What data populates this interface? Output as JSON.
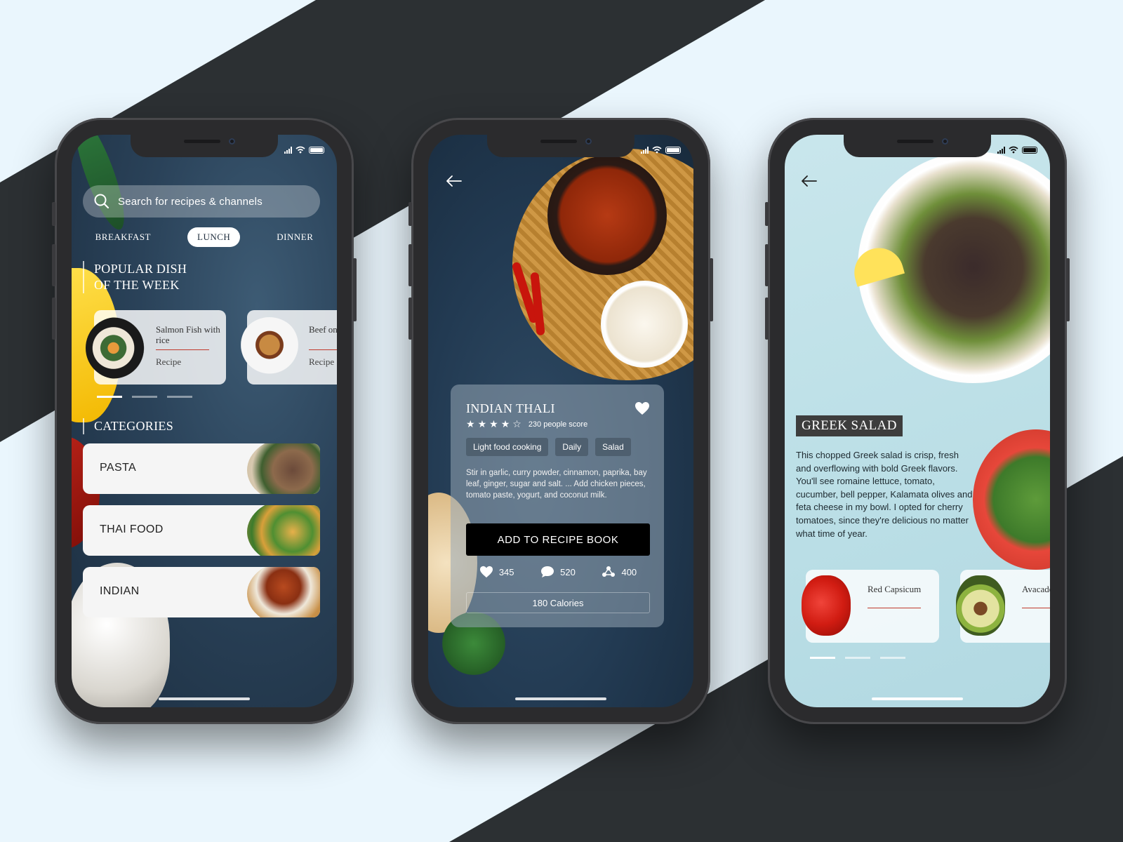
{
  "colors": {
    "page_background": "#eaf6fd",
    "stripe": "#2c3033",
    "accent_red": "#c0392b",
    "cta_black": "#000000"
  },
  "phone1": {
    "search": {
      "placeholder": "Search for recipes & channels",
      "icon": "search-icon"
    },
    "tabs": [
      {
        "label": "BREAKFAST",
        "active": false
      },
      {
        "label": "LUNCH",
        "active": true
      },
      {
        "label": "DINNER",
        "active": false
      }
    ],
    "popular": {
      "title_line1": "POPULAR DISH",
      "title_line2": "OF THE WEEK",
      "cards": [
        {
          "name": "Salmon Fish with rice",
          "sub": "Recipe"
        },
        {
          "name": "Beef onion",
          "sub": "Recipe"
        }
      ]
    },
    "categories": {
      "title": "CATEGORIES",
      "items": [
        {
          "label": "PASTA"
        },
        {
          "label": "THAI FOOD"
        },
        {
          "label": "INDIAN"
        }
      ]
    }
  },
  "phone2": {
    "title": "INDIAN THALI",
    "rating": {
      "stars": 4,
      "max": 5,
      "score_text": "230 people score"
    },
    "tags": [
      "Light food cooking",
      "Daily",
      "Salad"
    ],
    "description": "Stir in garlic, curry powder, cinnamon, paprika, bay leaf, ginger, sugar and salt. ... Add chicken pieces, tomato paste, yogurt, and coconut milk.",
    "cta": "ADD TO RECIPE BOOK",
    "metrics": {
      "likes": "345",
      "comments": "520",
      "shares": "400"
    },
    "calories": "180 Calories"
  },
  "phone3": {
    "title": "GREEK SALAD",
    "description": "This chopped Greek salad is crisp, fresh and overflowing with bold Greek flavors. You'll see romaine lettuce, tomato, cucumber, bell pepper, Kalamata olives and feta cheese in my bowl. I opted for cherry tomatoes, since they're delicious no matter what time of year.",
    "ingredients": [
      {
        "name": "Red Capsicum"
      },
      {
        "name": "Avacado onion"
      }
    ]
  }
}
